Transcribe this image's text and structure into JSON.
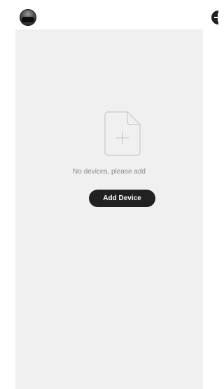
{
  "header": {
    "avatar_icon": "device-avatar-icon",
    "add_icon": "add-circle-icon"
  },
  "empty_state": {
    "icon": "add-document-icon",
    "message": "No devices, please add",
    "button_label": "Add Device"
  },
  "colors": {
    "panel_background": "#f0f0f0",
    "button_background": "#212121",
    "button_text": "#ffffff",
    "message_text": "#8a8a8a",
    "icon_stroke": "#cfcfcf"
  }
}
